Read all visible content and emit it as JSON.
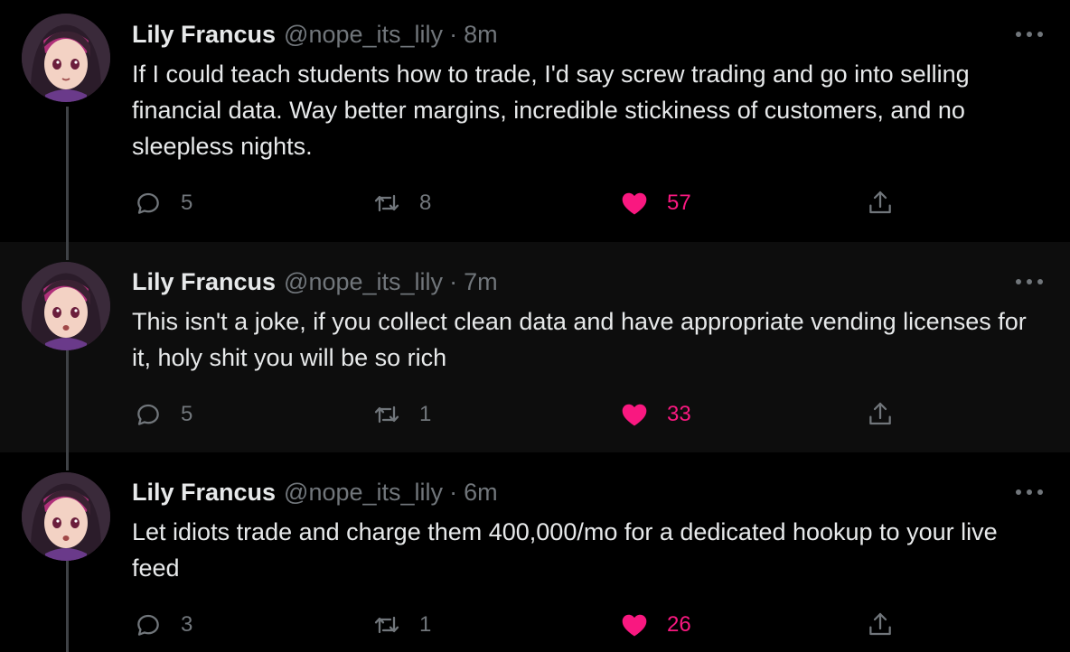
{
  "colors": {
    "background": "#000000",
    "alt_background": "#0d0d0d",
    "text": "#e7e9ea",
    "muted": "#71767b",
    "like": "#f91880",
    "thread_line": "#3f4246"
  },
  "icons": {
    "reply": "speech-bubble",
    "retweet": "retweet-arrows",
    "like": "heart-filled",
    "share": "upload-arrow",
    "more": "three-dots"
  },
  "tweets": [
    {
      "name": "Lily Francus",
      "handle": "@nope_its_lily",
      "separator": "·",
      "time": "8m",
      "text": "If I could teach students how to trade, I'd say screw trading and go into selling financial data. Way better margins, incredible stickiness of customers, and no sleepless nights.",
      "replies": "5",
      "retweets": "8",
      "likes": "57"
    },
    {
      "name": "Lily Francus",
      "handle": "@nope_its_lily",
      "separator": "·",
      "time": "7m",
      "text": "This isn't a joke, if you collect clean data and have appropriate vending licenses for it, holy shit you will be so rich",
      "replies": "5",
      "retweets": "1",
      "likes": "33"
    },
    {
      "name": "Lily Francus",
      "handle": "@nope_its_lily",
      "separator": "·",
      "time": "6m",
      "text": "Let idiots trade and charge them 400,000/mo for a dedicated hookup to your live feed",
      "replies": "3",
      "retweets": "1",
      "likes": "26"
    }
  ]
}
